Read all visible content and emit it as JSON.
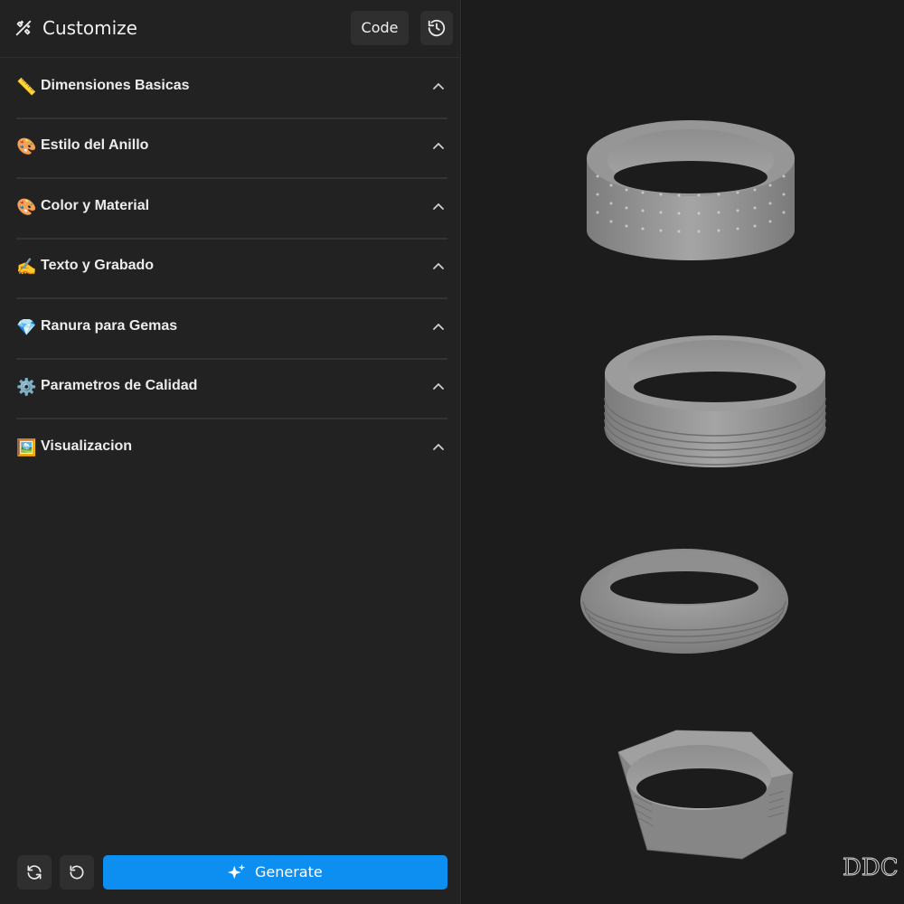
{
  "header": {
    "title": "Customize",
    "code_label": "Code"
  },
  "sections": [
    {
      "emoji": "📏",
      "label": "Dimensiones Basicas"
    },
    {
      "emoji": "🎨",
      "label": "Estilo del Anillo"
    },
    {
      "emoji": "🎨",
      "label": "Color y Material"
    },
    {
      "emoji": "✍️",
      "label": "Texto y Grabado"
    },
    {
      "emoji": "💎",
      "label": "Ranura para Gemas"
    },
    {
      "emoji": "⚙️",
      "label": "Parametros de Calidad"
    },
    {
      "emoji": "🖼️",
      "label": "Visualizacion"
    }
  ],
  "footer": {
    "generate_label": "Generate"
  },
  "viewer": {
    "models": [
      "dotted-band-ring",
      "grooved-band-ring",
      "rounded-comfort-ring",
      "hexagonal-ring"
    ],
    "watermark": "DDC"
  },
  "colors": {
    "accent": "#0d8ff2",
    "panel": "#222222",
    "viewport": "#1c1c1c",
    "ring": "#9a9a9a"
  }
}
